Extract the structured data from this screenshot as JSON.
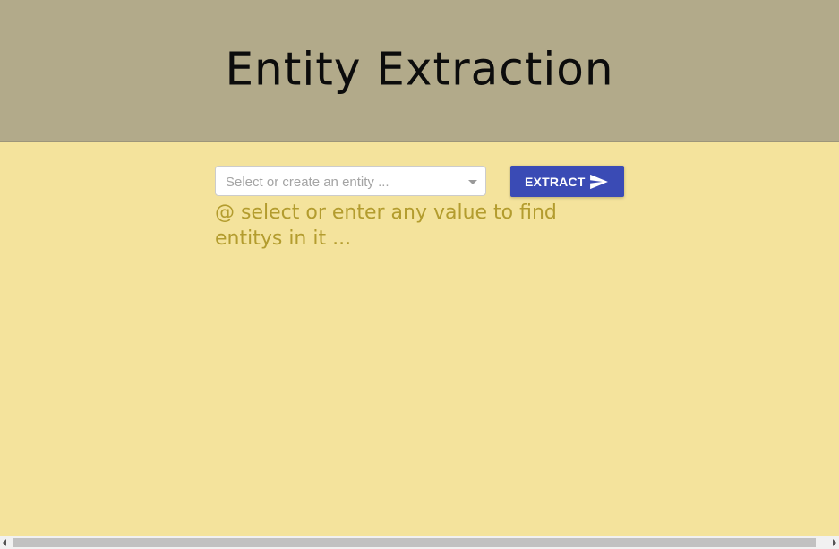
{
  "header": {
    "title": "Entity Extraction",
    "background": "#b2aa8a"
  },
  "entity_select": {
    "placeholder": "Select or create an entity ...",
    "icon": "chevron-down-icon"
  },
  "extract_button": {
    "label": "EXTRACT",
    "icon": "send-icon",
    "color": "#3a4bb5"
  },
  "hint": {
    "text": "@ select or enter any value to find entitys in it ...",
    "color": "#b39c2e"
  },
  "page": {
    "background": "#f4e39c"
  }
}
